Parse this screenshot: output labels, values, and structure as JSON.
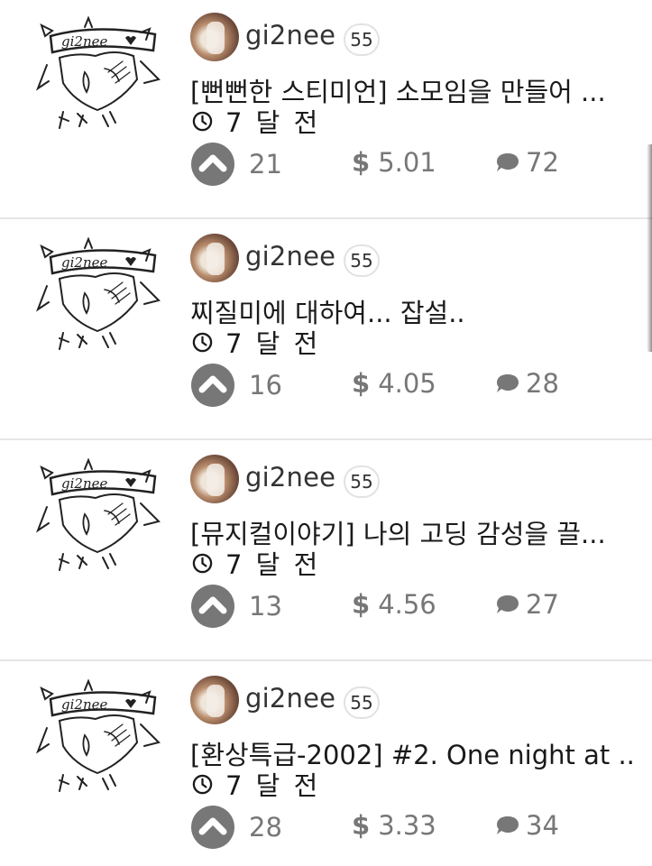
{
  "posts": [
    {
      "author": "gi2nee",
      "reputation": "55",
      "title": "[뻔뻔한 스티미언] 소모임을 만들어 ...",
      "time": "7 달 전",
      "votes": "21",
      "payout": "5.01",
      "comments": "72"
    },
    {
      "author": "gi2nee",
      "reputation": "55",
      "title": "찌질미에 대하여... 잡설..",
      "time": "7 달 전",
      "votes": "16",
      "payout": "4.05",
      "comments": "28"
    },
    {
      "author": "gi2nee",
      "reputation": "55",
      "title": "[뮤지컬이야기] 나의 고딩 감성을 끌...",
      "time": "7 달 전",
      "votes": "13",
      "payout": "4.56",
      "comments": "27"
    },
    {
      "author": "gi2nee",
      "reputation": "55",
      "title": "[환상특급-2002] #2. One night at ...",
      "time": "7 달 전",
      "votes": "28",
      "payout": "3.33",
      "comments": "34"
    }
  ],
  "thumbnail_text": "gi2nee",
  "currency_symbol": "$",
  "icons": {
    "clock": "clock-icon",
    "upvote": "chevron-up-icon",
    "comment": "chat-bubble-icon"
  },
  "colors": {
    "meta_gray": "#777777",
    "title": "#1a1a1a",
    "author": "#333333",
    "divider": "#e6e6e6"
  }
}
